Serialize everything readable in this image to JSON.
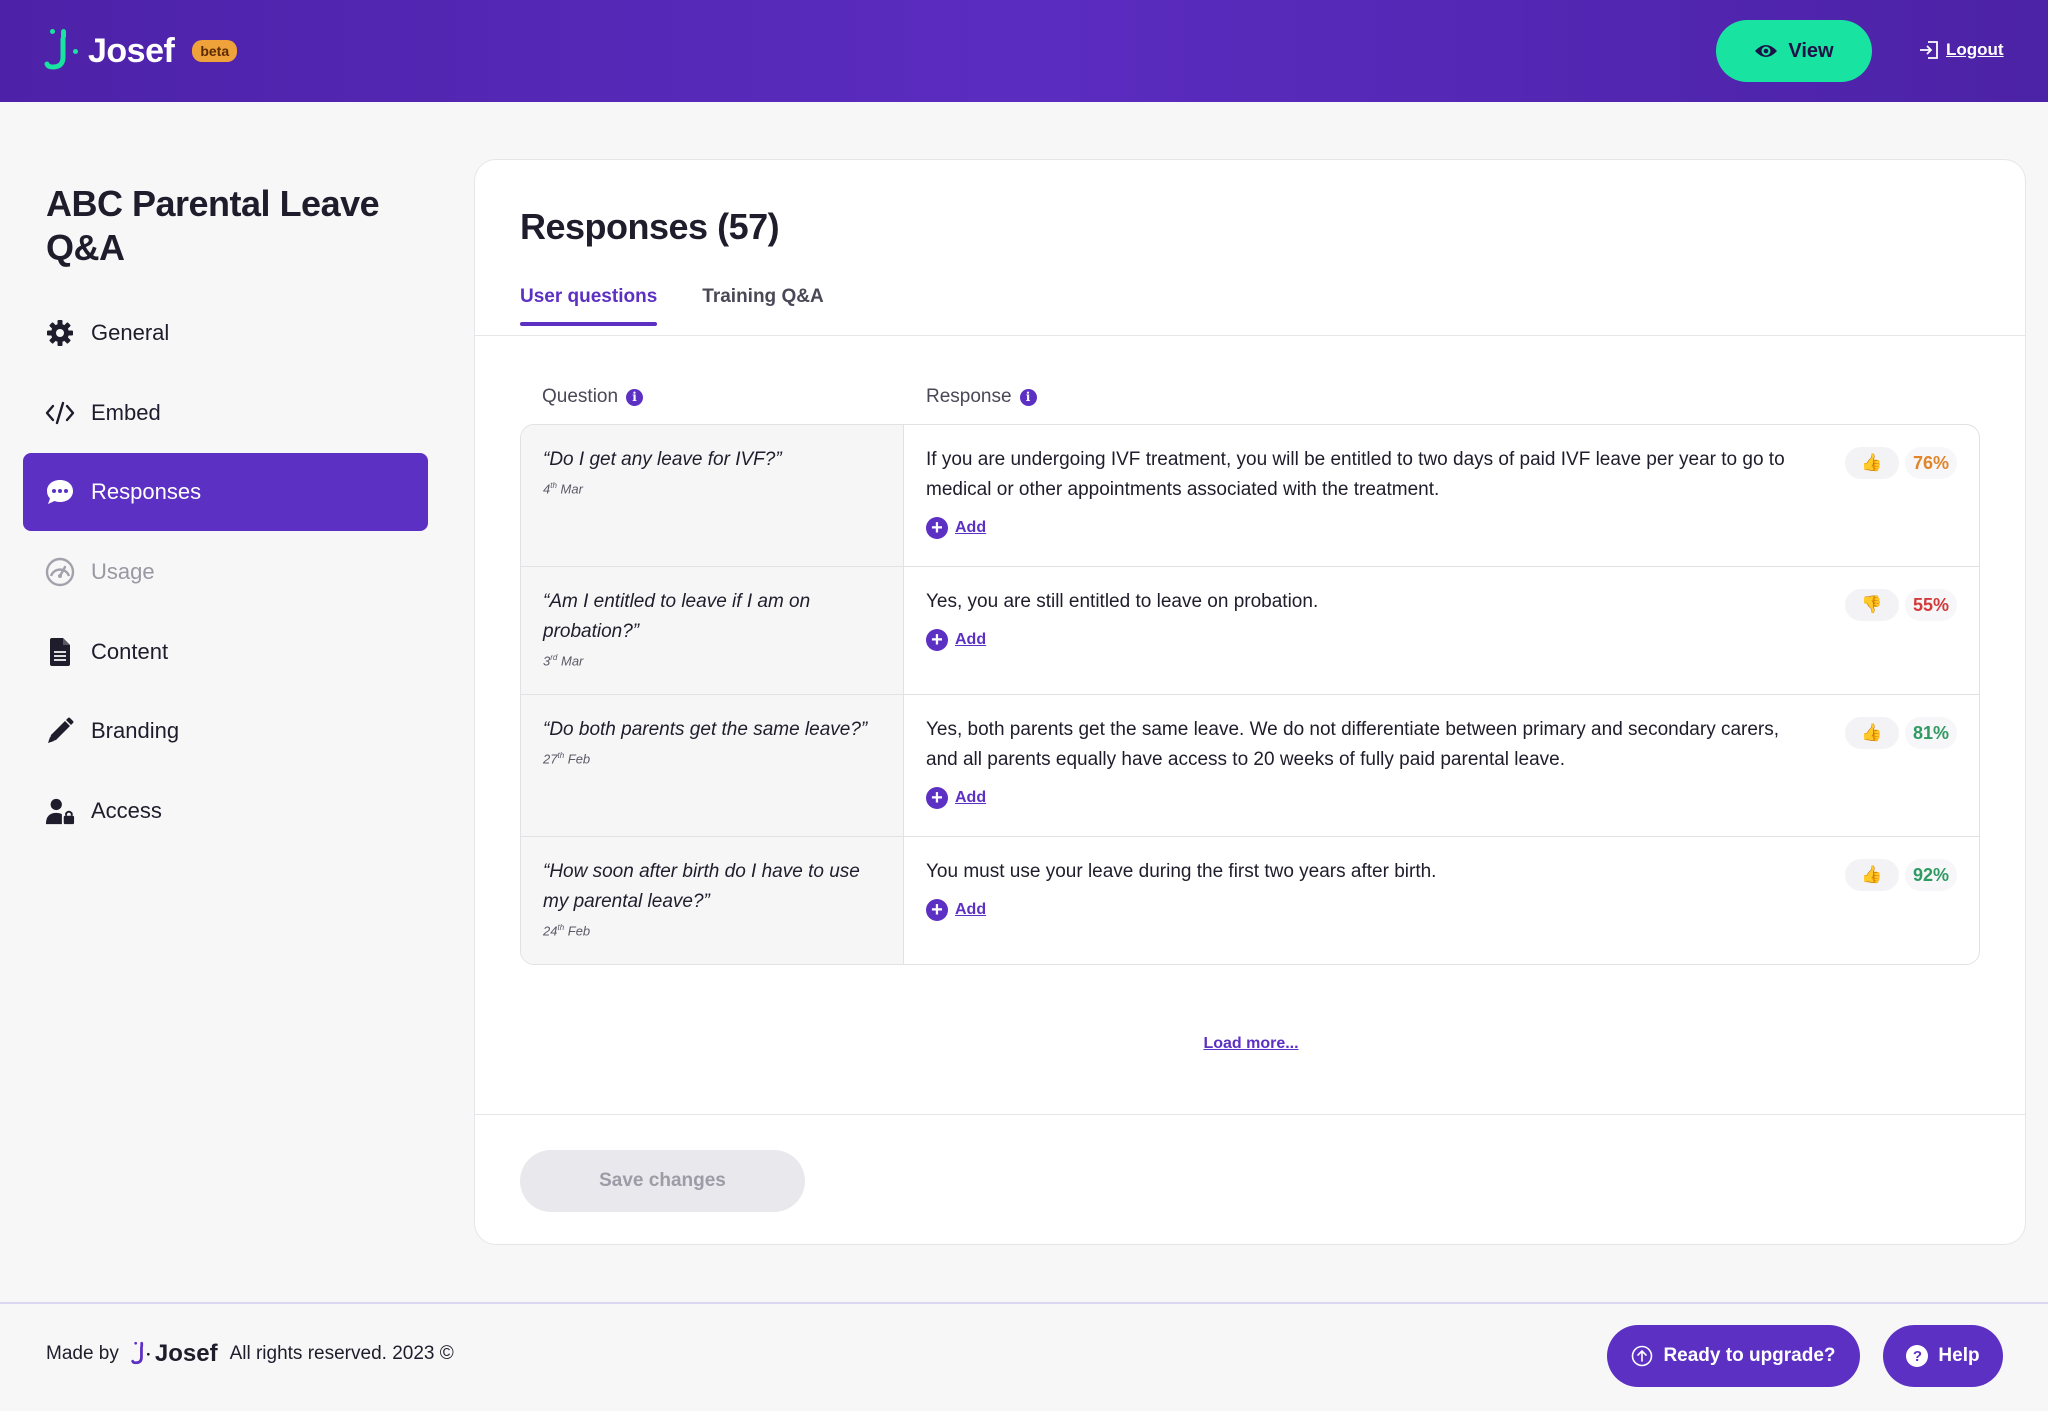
{
  "header": {
    "logo_text": "Josef",
    "beta_badge": "beta",
    "view_label": "View",
    "logout_label": "Logout"
  },
  "sidebar": {
    "title": "ABC Parental Leave Q&A",
    "items": [
      {
        "label": "General",
        "icon": "gear-icon",
        "state": "normal"
      },
      {
        "label": "Embed",
        "icon": "code-icon",
        "state": "normal"
      },
      {
        "label": "Responses",
        "icon": "chat-bubble-icon",
        "state": "active"
      },
      {
        "label": "Usage",
        "icon": "gauge-icon",
        "state": "disabled"
      },
      {
        "label": "Content",
        "icon": "document-icon",
        "state": "normal"
      },
      {
        "label": "Branding",
        "icon": "pencil-icon",
        "state": "normal"
      },
      {
        "label": "Access",
        "icon": "user-lock-icon",
        "state": "normal"
      }
    ]
  },
  "main": {
    "title": "Responses (57)",
    "tabs": [
      {
        "label": "User questions",
        "active": true
      },
      {
        "label": "Training Q&A",
        "active": false
      }
    ],
    "columns": {
      "question": "Question",
      "response": "Response"
    },
    "add_label": "Add",
    "rows": [
      {
        "question": "“Do I get any leave for IVF?”",
        "date_day": "4",
        "date_suffix": "th",
        "date_month": "Mar",
        "response": "If you are undergoing IVF treatment, you will be entitled to two days of paid IVF leave per year to go to medical or other appointments associated with the treatment.",
        "thumb": "up",
        "percent": "76%"
      },
      {
        "question": "“Am I entitled to leave if I am on probation?”",
        "date_day": "3",
        "date_suffix": "rd",
        "date_month": "Mar",
        "response": "Yes, you are still entitled to leave on probation.",
        "thumb": "down",
        "percent": "55%"
      },
      {
        "question": "“Do both parents get the same leave?”",
        "date_day": "27",
        "date_suffix": "th",
        "date_month": "Feb",
        "response": "Yes, both parents get the same leave. We do not differentiate between primary and secondary carers, and all parents equally have access to 20 weeks of fully paid parental leave.",
        "thumb": "up",
        "percent": "81%"
      },
      {
        "question": "“How soon after birth do I have to use my parental leave?”",
        "date_day": "24",
        "date_suffix": "th",
        "date_month": "Feb",
        "response": "You must use your leave during the first two years after birth.",
        "thumb": "up",
        "percent": "92%"
      }
    ],
    "load_more": "Load more...",
    "save_label": "Save changes"
  },
  "footer": {
    "made_by": "Made by",
    "logo_text": "Josef",
    "rights": "All rights reserved. 2023 ©",
    "upgrade_label": "Ready to upgrade?",
    "help_label": "Help"
  },
  "colors": {
    "brand_purple": "#5d30c4",
    "accent_green": "#19e3a1",
    "beta_orange": "#f0a23a",
    "pct_orange": "#e0852a",
    "pct_red": "#d23b3b",
    "pct_green": "#2f9a62"
  }
}
